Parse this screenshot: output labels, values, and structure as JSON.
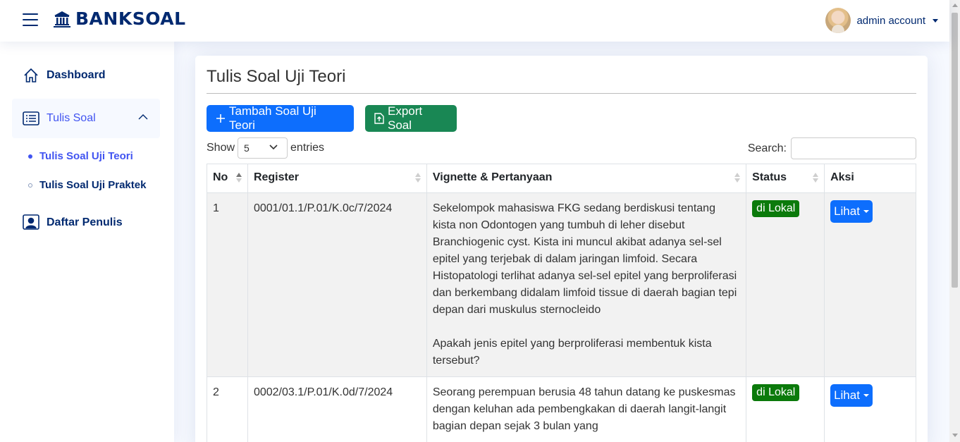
{
  "header": {
    "app_name": "BANKSOAL",
    "user_name": "admin account"
  },
  "sidebar": {
    "items": [
      {
        "label": "Dashboard",
        "icon": "house-icon"
      },
      {
        "label": "Tulis Soal",
        "icon": "list-icon"
      },
      {
        "label": "Daftar Penulis",
        "icon": "person-badge-icon"
      }
    ],
    "subitems": [
      {
        "label": "Tulis Soal Uji Teori"
      },
      {
        "label": "Tulis Soal Uji Praktek"
      }
    ]
  },
  "main": {
    "title": "Tulis Soal Uji Teori",
    "add_button": "Tambah Soal Uji Teori",
    "export_button": "Export Soal",
    "show_label": "Show",
    "entries_value": "5",
    "entries_label": "entries",
    "search_label": "Search:",
    "columns": [
      "No",
      "Register",
      "Vignette & Pertanyaan",
      "Status",
      "Aksi"
    ],
    "rows": [
      {
        "no": "1",
        "register": "0001/01.1/P.01/K.0c/7/2024",
        "vignette": "Sekelompok mahasiswa FKG sedang berdiskusi tentang kista non Odontogen yang tumbuh di leher disebut Branchiogenic cyst. Kista ini muncul  akibat adanya  sel-sel  epitel yang terjebak di dalam jaringan limfoid. Secara  Histopatologi  terlihat  adanya  sel-sel  epitel  yang berproliferasi  dan  berkembang  didalam  limfoid tissue  di  daerah  bagian  tepi  depan  dari  muskulus  sternocleido\n\nApakah  jenis  epitel  yang berproliferasi membentuk kista tersebut?",
        "status": "di Lokal",
        "action": "Lihat"
      },
      {
        "no": "2",
        "register": "0002/03.1/P.01/K.0d/7/2024",
        "vignette": "Seorang  perempuan  berusia  48  tahun  datang  ke  puskesmas  dengan  keluhan  ada  pembengkakan  di  daerah langit-langit  bagian depan  sejak  3  bulan  yang",
        "status": "di Lokal",
        "action": "Lihat"
      }
    ]
  },
  "colors": {
    "brand": "#012970",
    "accent": "#4154f1",
    "primary": "#0d6efd",
    "success": "#198754",
    "badge": "#0b7a0b"
  }
}
